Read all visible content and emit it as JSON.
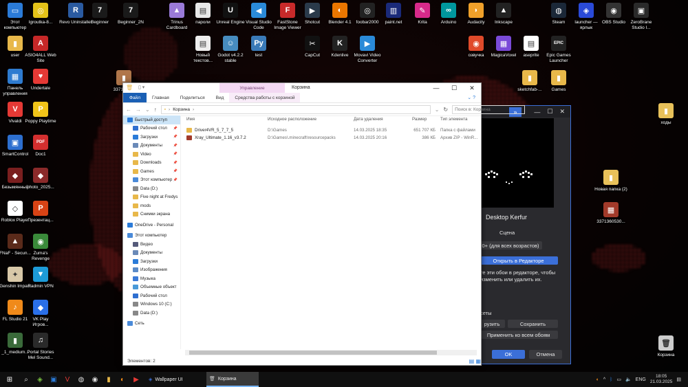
{
  "desktop": {
    "left_icons": [
      {
        "label": "Этот компьютер",
        "color": "#2b7bd8",
        "glyph": "▭",
        "icon": "computer-icon"
      },
      {
        "label": "Igroutka-8...",
        "color": "#e4c319",
        "glyph": "◎",
        "icon": "game-icon"
      },
      {
        "label": "user",
        "color": "#e8b84a",
        "glyph": "▮",
        "icon": "folder-icon"
      },
      {
        "label": "ASIO4ALL Web Site",
        "color": "#c62828",
        "glyph": "A",
        "icon": "asio-icon"
      },
      {
        "label": "Панель управления",
        "color": "#2e7bd0",
        "glyph": "▦",
        "icon": "control-panel-icon"
      },
      {
        "label": "Undertale",
        "color": "#e53935",
        "glyph": "♥",
        "icon": "undertale-icon"
      },
      {
        "label": "Vivaldi",
        "color": "#e53935",
        "glyph": "V",
        "icon": "vivaldi-icon"
      },
      {
        "label": "Poppy Playtime",
        "color": "#f0c419",
        "glyph": "P",
        "icon": "poppy-icon"
      },
      {
        "label": "SmartControl",
        "color": "#2d6fcf",
        "glyph": "▣",
        "icon": "smartcontrol-icon"
      },
      {
        "label": "Doc1",
        "color": "#d32f2f",
        "glyph": "PDF",
        "icon": "pdf-icon"
      },
      {
        "label": "Безымянный",
        "color": "#7a1f1f",
        "glyph": "◆",
        "icon": "image-icon"
      },
      {
        "label": "photo_2025...",
        "color": "#8b2a2a",
        "glyph": "◆",
        "icon": "image-icon"
      },
      {
        "label": "Roblox Player",
        "color": "#ffffff",
        "glyph": "◇",
        "icon": "roblox-icon"
      },
      {
        "label": "Презентац...",
        "color": "#d84315",
        "glyph": "P",
        "icon": "powerpoint-icon"
      },
      {
        "label": "FNaF - Secun...",
        "color": "#5a2a1a",
        "glyph": "▲",
        "icon": "fnaf-icon"
      },
      {
        "label": "Zuma's Revenge",
        "color": "#3a8a3a",
        "glyph": "◉",
        "icon": "zuma-icon"
      },
      {
        "label": "Genshin Impact",
        "color": "#d8c8a8",
        "glyph": "✦",
        "icon": "genshin-icon"
      },
      {
        "label": "Radmin VPN",
        "color": "#1d9bd8",
        "glyph": "▼",
        "icon": "radmin-icon"
      },
      {
        "label": "FL Studio 21",
        "color": "#f08a1a",
        "glyph": "♪",
        "icon": "flstudio-icon"
      },
      {
        "label": "VK Play Игров...",
        "color": "#2a6fe8",
        "glyph": "◆",
        "icon": "vkplay-icon"
      },
      {
        "label": "_1_medium...",
        "color": "#3a6a3a",
        "glyph": "▮",
        "icon": "image-icon"
      },
      {
        "label": "Portal Stories Mel Sound...",
        "color": "#2a2a2a",
        "glyph": "♫",
        "icon": "music-icon"
      }
    ],
    "top_icons": [
      {
        "label": "Revo Uninstaller",
        "color": "#2a5aa0",
        "glyph": "R",
        "icon": "revo-icon"
      },
      {
        "label": "Beginner",
        "color": "#1a1a1a",
        "glyph": "7",
        "icon": "beginner-icon"
      },
      {
        "label": "Beginner_2N",
        "color": "#1a1a1a",
        "glyph": "7",
        "icon": "beginner-icon"
      },
      {
        "label": "Trinus Cardboard",
        "color": "#9a7ad8",
        "glyph": "▲",
        "icon": "trinus-icon"
      },
      {
        "label": "пароли",
        "color": "#e8e8e8",
        "glyph": "▤",
        "icon": "document-icon"
      },
      {
        "label": "Unreal Engine",
        "color": "#111111",
        "glyph": "U",
        "icon": "unreal-icon"
      },
      {
        "label": "Visual Studio Code",
        "color": "#2a8ad8",
        "glyph": "◀",
        "icon": "vscode-icon"
      },
      {
        "label": "FastStone Image Viewer",
        "color": "#c82a2a",
        "glyph": "F",
        "icon": "faststone-icon"
      },
      {
        "label": "Shotcut",
        "color": "#2a3a4a",
        "glyph": "▶",
        "icon": "shotcut-icon"
      },
      {
        "label": "Blender 4.1",
        "color": "#ea7600",
        "glyph": "◐",
        "icon": "blender-icon"
      },
      {
        "label": "foobar2000",
        "color": "#222222",
        "glyph": "◎",
        "icon": "foobar-icon"
      },
      {
        "label": "paint.net",
        "color": "#1a2a7a",
        "glyph": "▥",
        "icon": "paintnet-icon"
      },
      {
        "label": "Krita",
        "color": "#d82a8a",
        "glyph": "✎",
        "icon": "krita-icon"
      },
      {
        "label": "Arduino",
        "color": "#00979d",
        "glyph": "∞",
        "icon": "arduino-icon"
      },
      {
        "label": "Audacity",
        "color": "#f0a02a",
        "glyph": "◗",
        "icon": "audacity-icon"
      },
      {
        "label": "Inkscape",
        "color": "#222222",
        "glyph": "▲",
        "icon": "inkscape-icon"
      },
      {
        "label": "Steam",
        "color": "#1b2838",
        "glyph": "◍",
        "icon": "steam-icon"
      },
      {
        "label": "launcher — ярлык",
        "color": "#2a4ad8",
        "glyph": "◈",
        "icon": "launcher-icon"
      },
      {
        "label": "OBS Studio",
        "color": "#333333",
        "glyph": "◉",
        "icon": "obs-icon"
      },
      {
        "label": "ZeroBrane Studio I...",
        "color": "#2a2a2a",
        "glyph": "▣",
        "icon": "zerobrane-icon"
      },
      {
        "label": "Новый текстов...",
        "color": "#eeeeee",
        "glyph": "▤",
        "icon": "text-file-icon"
      },
      {
        "label": "Godot v4.2.2 stable",
        "color": "#478cbf",
        "glyph": "☺",
        "icon": "godot-icon"
      },
      {
        "label": "test",
        "color": "#3a7ab8",
        "glyph": "Py",
        "icon": "python-file-icon"
      },
      {
        "label": "CapCut",
        "color": "#111111",
        "glyph": "✂",
        "icon": "capcut-icon"
      },
      {
        "label": "Kdenlive",
        "color": "#222222",
        "glyph": "K",
        "icon": "kdenlive-icon"
      },
      {
        "label": "Movavi Video Converter",
        "color": "#2a8ad8",
        "glyph": "▶",
        "icon": "movavi-icon"
      },
      {
        "label": "озвучка",
        "color": "#e04a2a",
        "glyph": "◉",
        "icon": "voice-icon"
      },
      {
        "label": "MagicaVoxel",
        "color": "#7a4ad8",
        "glyph": "▦",
        "icon": "magicavoxel-icon"
      },
      {
        "label": "aseprite",
        "color": "#ffffff",
        "glyph": "▤",
        "icon": "aseprite-icon"
      },
      {
        "label": "Epic Games Launcher",
        "color": "#222222",
        "glyph": "EPIC",
        "icon": "epic-icon"
      },
      {
        "label": "3371360...",
        "color": "#b0764a",
        "glyph": "▮",
        "icon": "image-icon"
      },
      {
        "label": "sketchfab-...",
        "color": "#e8b84a",
        "glyph": "▮",
        "icon": "folder-icon"
      },
      {
        "label": "Games",
        "color": "#e8b84a",
        "glyph": "▮",
        "icon": "folder-icon"
      }
    ],
    "right_icons": [
      {
        "label": "ходы",
        "color": "#e8c15a",
        "glyph": "▮",
        "icon": "folder-icon"
      },
      {
        "label": "Новая папка (2)",
        "color": "#e8c15a",
        "glyph": "▮",
        "icon": "folder-icon"
      },
      {
        "label": "3371360530...",
        "color": "#a23a2a",
        "glyph": "▦",
        "icon": "archive-icon"
      },
      {
        "label": "Корзина",
        "color": "#cccccc",
        "glyph": "🗑",
        "icon": "recycle-bin-icon"
      }
    ]
  },
  "wallpaper_ui": {
    "title": "Desktop Kerfur",
    "type": "Сцена",
    "rating": "0+ (для всех возрастов)",
    "open_editor": "Открыть в Редакторе",
    "editor_text": "те эти обои в редакторе, чтобы изменить или удалить их.",
    "presets": "сеты",
    "load": "рузить",
    "save": "Сохранить",
    "apply_all": "Применить ко всем обоям",
    "ok": "OK",
    "cancel": "Отмена",
    "accent": "#3b6fd8"
  },
  "explorer": {
    "ctx_tab": "Управление",
    "window_title": "Корзина",
    "ribbon": {
      "file": "Файл",
      "home": "Главная",
      "share": "Поделиться",
      "view": "Вид",
      "recycle_tools": "Средства работы с корзиной"
    },
    "address": "Корзина",
    "search_placeholder": "Поиск в: Корзина",
    "nav": [
      {
        "label": "Быстрый доступ",
        "color": "#2b7bd8",
        "icon": "star-icon",
        "pin": ""
      },
      {
        "label": "Рабочий стол",
        "color": "#2e6fd0",
        "icon": "desktop-icon",
        "pin": "📌"
      },
      {
        "label": "Загрузки",
        "color": "#2b7bd8",
        "icon": "downloads-icon",
        "pin": "📌"
      },
      {
        "label": "Документы",
        "color": "#6a8ab8",
        "icon": "documents-icon",
        "pin": "📌"
      },
      {
        "label": "Video",
        "color": "#e8b84a",
        "icon": "folder-icon",
        "pin": "📌"
      },
      {
        "label": "Downloads",
        "color": "#e8b84a",
        "icon": "folder-icon",
        "pin": "📌"
      },
      {
        "label": "Games",
        "color": "#e8b84a",
        "icon": "folder-icon",
        "pin": "📌"
      },
      {
        "label": "Этот компьютер",
        "color": "#4a8ad8",
        "icon": "computer-icon",
        "pin": "📌"
      },
      {
        "label": "Data (D:)",
        "color": "#888888",
        "icon": "drive-icon",
        "pin": ""
      },
      {
        "label": "Five night at Fredys",
        "color": "#e8b84a",
        "icon": "folder-icon",
        "pin": ""
      },
      {
        "label": "mods",
        "color": "#e8b84a",
        "icon": "folder-icon",
        "pin": ""
      },
      {
        "label": "Снимки экрана",
        "color": "#e8b84a",
        "icon": "folder-icon",
        "pin": ""
      },
      {
        "label": "OneDrive - Personal",
        "color": "#2b7bd8",
        "icon": "onedrive-icon",
        "pin": ""
      },
      {
        "label": "Этот компьютер",
        "color": "#4a8ad8",
        "icon": "computer-icon",
        "pin": ""
      },
      {
        "label": "Видео",
        "color": "#555a7a",
        "icon": "video-icon",
        "pin": ""
      },
      {
        "label": "Документы",
        "color": "#6a8ab8",
        "icon": "documents-icon",
        "pin": ""
      },
      {
        "label": "Загрузки",
        "color": "#2b7bd8",
        "icon": "downloads-icon",
        "pin": ""
      },
      {
        "label": "Изображения",
        "color": "#5a8ac8",
        "icon": "pictures-icon",
        "pin": ""
      },
      {
        "label": "Музыка",
        "color": "#3a7ad8",
        "icon": "music-icon",
        "pin": ""
      },
      {
        "label": "Объемные объект",
        "color": "#4a9ad8",
        "icon": "3d-objects-icon",
        "pin": ""
      },
      {
        "label": "Рабочий стол",
        "color": "#2e6fd0",
        "icon": "desktop-icon",
        "pin": ""
      },
      {
        "label": "Windows 10 (C:)",
        "color": "#888888",
        "icon": "drive-icon",
        "pin": ""
      },
      {
        "label": "Data (D:)",
        "color": "#888888",
        "icon": "drive-icon",
        "pin": ""
      },
      {
        "label": "Сеть",
        "color": "#4a8ad8",
        "icon": "network-icon",
        "pin": ""
      }
    ],
    "columns": [
      "Имя",
      "Исходное расположение",
      "Дата удаления",
      "Размер",
      "Тип элемента"
    ],
    "rows": [
      {
        "name": "Driver4VR_5_7_7_5",
        "location": "D:\\Games",
        "deleted": "14.03.2025 18:35",
        "size": "651 707 КБ",
        "type": "Папка с файлами",
        "color": "#e8b84a",
        "icon": "folder-icon"
      },
      {
        "name": "Xray_Ultimate_1.16_v3.7.2",
        "location": "D:\\Games\\.minecraft\\resourcepacks",
        "deleted": "14.03.2025 20:16",
        "size": "386 КБ",
        "type": "Архив ZIP - WinR...",
        "color": "#a23a2a",
        "icon": "winrar-icon"
      }
    ],
    "status": "Элементов: 2"
  },
  "taskbar": {
    "apps": [
      {
        "label": "Wallpaper UI",
        "active": false
      },
      {
        "label": "Корзина",
        "active": true
      }
    ],
    "lang": "ENG",
    "time": "18:05",
    "date": "21.03.2025"
  }
}
